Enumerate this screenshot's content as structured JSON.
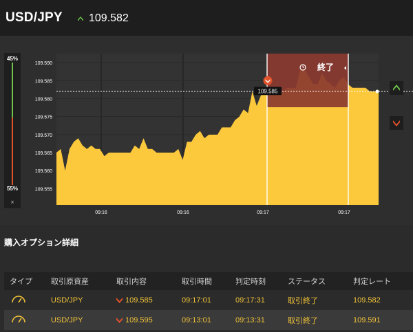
{
  "header": {
    "pair": "USD/JPY",
    "rate": "109.582",
    "direction_icon": "up-chevron-icon",
    "up_color": "#6cc24a"
  },
  "gauge": {
    "up_percent": "45%",
    "down_percent": "55%",
    "close_label": "×",
    "up_color": "#6cc24a",
    "down_color": "#e0522a"
  },
  "chart": {
    "y_ticks": [
      "109.590",
      "109.585",
      "109.580",
      "109.575",
      "109.570",
      "109.565",
      "109.560",
      "109.555"
    ],
    "x_ticks": [
      "09:16",
      "09:16",
      "09:17",
      "09:17"
    ],
    "end_label": "終了",
    "entry_marker_value": "109.585",
    "fill_color": "#fcc93c",
    "end_zone_color": "#8b3a30"
  },
  "chart_data": {
    "type": "area",
    "xlabel": "",
    "ylabel": "",
    "ylim": [
      109.5505,
      109.5925
    ],
    "y_ticks": [
      109.59,
      109.585,
      109.58,
      109.575,
      109.57,
      109.565,
      109.56,
      109.555
    ],
    "x_tick_labels": [
      "09:16",
      "09:16",
      "09:17",
      "09:17"
    ],
    "x": [
      0,
      1,
      2,
      3,
      4,
      5,
      6,
      7,
      8,
      9,
      10,
      11,
      12,
      13,
      14,
      15,
      16,
      17,
      18,
      19,
      20,
      21,
      22,
      23,
      24,
      25,
      26,
      27,
      28,
      29,
      30,
      31,
      32,
      33,
      34,
      35,
      36,
      37,
      38,
      39,
      40,
      41,
      42,
      43,
      44,
      45,
      46,
      47,
      48,
      49,
      50,
      51,
      52,
      53,
      54,
      55,
      56,
      57,
      58,
      59,
      60,
      61,
      62,
      63,
      64,
      65,
      66,
      67,
      68,
      69,
      70,
      71,
      72,
      73,
      74
    ],
    "values": [
      109.565,
      109.566,
      109.56,
      109.566,
      109.568,
      109.569,
      109.567,
      109.566,
      109.567,
      109.566,
      109.566,
      109.564,
      109.565,
      109.565,
      109.565,
      109.565,
      109.565,
      109.565,
      109.567,
      109.566,
      109.569,
      109.566,
      109.566,
      109.565,
      109.565,
      109.565,
      109.565,
      109.565,
      109.566,
      109.563,
      109.568,
      109.568,
      109.57,
      109.571,
      109.569,
      109.57,
      109.57,
      109.57,
      109.572,
      109.572,
      109.572,
      109.574,
      109.575,
      109.577,
      109.576,
      109.582,
      109.578,
      109.581,
      109.582,
      109.582,
      109.581,
      109.582,
      109.582,
      109.583,
      109.583,
      109.583,
      109.588,
      109.588,
      109.586,
      109.584,
      109.584,
      109.587,
      109.585,
      109.584,
      109.583,
      109.585,
      109.586,
      109.584,
      109.583,
      109.583,
      109.583,
      109.583,
      109.582,
      109.582,
      109.582
    ],
    "series": [
      {
        "values_ref": "values"
      }
    ],
    "reference_lines": [
      {
        "value": 109.582,
        "style": "dashed",
        "color": "#ffffff"
      }
    ],
    "grid": true,
    "color": "#fcc93c"
  },
  "details": {
    "title": "購入オプション詳細",
    "columns": [
      "タイプ",
      "取引原資産",
      "取引内容",
      "取引時間",
      "判定時刻",
      "ステータス",
      "判定レート"
    ],
    "rows": [
      {
        "type_icon": "gauge-icon",
        "asset": "USD/JPY",
        "direction_icon": "down-chevron-icon",
        "content": "109.585",
        "trade_time": "09:17:01",
        "judge_time": "09:17:31",
        "status": "取引終了",
        "judge_rate": "109.582"
      },
      {
        "type_icon": "gauge-icon",
        "asset": "USD/JPY",
        "direction_icon": "down-chevron-icon",
        "content": "109.595",
        "trade_time": "09:13:01",
        "judge_time": "09:13:31",
        "status": "取引終了",
        "judge_rate": "109.591"
      }
    ],
    "down_color": "#e0522a",
    "text_color": "#f0c238"
  },
  "side_buttons": [
    {
      "icon": "up-chevron-icon",
      "color": "#6cc24a"
    },
    {
      "icon": "down-chevron-icon",
      "color": "#e0522a"
    }
  ]
}
